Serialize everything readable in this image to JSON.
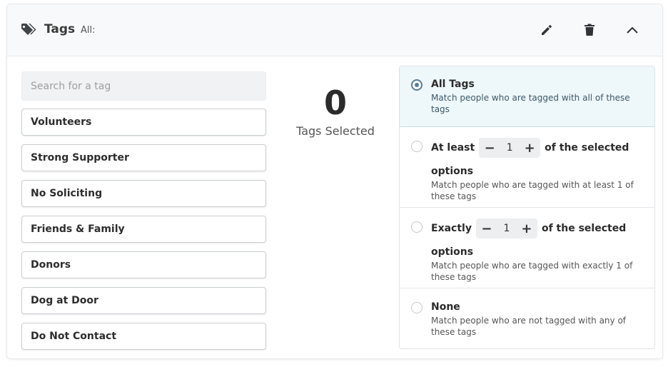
{
  "header": {
    "title": "Tags",
    "subtitle": "All:",
    "icons": {
      "tag": "tag-icon",
      "edit": "pencil-icon",
      "delete": "trash-icon",
      "collapse": "chevron-up-icon"
    }
  },
  "search": {
    "placeholder": "Search for a tag",
    "value": ""
  },
  "tags": [
    {
      "label": "Volunteers"
    },
    {
      "label": "Strong Supporter"
    },
    {
      "label": "No Soliciting"
    },
    {
      "label": "Friends & Family"
    },
    {
      "label": "Donors"
    },
    {
      "label": "Dog at Door"
    },
    {
      "label": "Do Not Contact"
    }
  ],
  "selection": {
    "count": "0",
    "label": "Tags Selected"
  },
  "options": {
    "all": {
      "title": "All Tags",
      "desc": "Match people who are tagged with all of these tags",
      "selected": true
    },
    "at_least": {
      "prefix": "At least",
      "value": "1",
      "suffix": "of the selected",
      "suffix2": "options",
      "desc": "Match people who are tagged with at least 1 of these tags"
    },
    "exactly": {
      "prefix": "Exactly",
      "value": "1",
      "suffix": "of the selected",
      "suffix2": "options",
      "desc": "Match people who are tagged with exactly 1 of these tags"
    },
    "none": {
      "title": "None",
      "desc": "Match people who are not tagged with any of these tags"
    }
  },
  "stepper": {
    "minus": "−",
    "plus": "+"
  },
  "colors": {
    "accent": "#5a7d93",
    "selected_bg": "#eef7fa",
    "header_bg": "#f8f9fa"
  }
}
